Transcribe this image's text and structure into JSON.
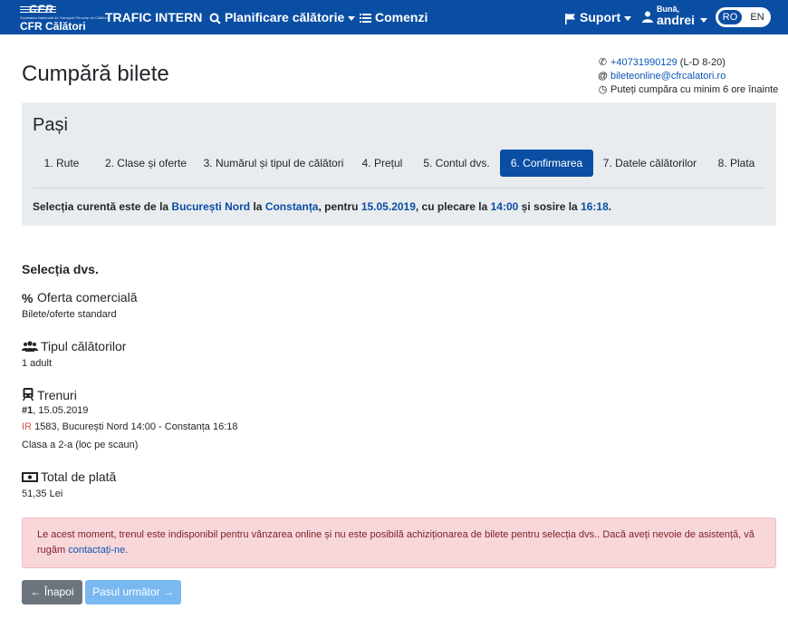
{
  "navbar": {
    "logo_mark": "CFR",
    "logo_tiny": "Societatea Națională de Transport Feroviar de Călători",
    "logo_name": "CFR Călători",
    "trafic": "TRAFIC INTERN",
    "planificare": "Planificare călătorie",
    "comenzi": "Comenzi",
    "suport": "Suport",
    "greeting": "Bună,",
    "username": "andrei",
    "lang_ro": "RO",
    "lang_en": "EN"
  },
  "header": {
    "title": "Cumpără bilete",
    "phone": "+40731990129",
    "phone_hours": "(L-D 8-20)",
    "email": "bileteonline@cfrcalatori.ro",
    "notice": "Puteți cumpăra cu minim 6 ore înainte"
  },
  "steps": {
    "title": "Pași",
    "items": [
      "1. Rute",
      "2. Clase și oferte",
      "3. Numărul și tipul de călători",
      "4. Prețul",
      "5. Contul dvs.",
      "6. Confirmarea",
      "7. Datele călătorilor",
      "8. Plata"
    ],
    "active_index": 5
  },
  "current_selection": {
    "prefix": "Selecția curentă este de la",
    "from": "București Nord",
    "to_word": "la",
    "to": "Constanța",
    "for_word": ", pentru",
    "date": "15.05.2019",
    "depart_word": ", cu plecare la",
    "depart": "14:00",
    "arrive_word": "și sosire la",
    "arrive": "16:18",
    "end": "."
  },
  "selection": {
    "title": "Selecția dvs.",
    "offer_label": "Oferta comercială",
    "offer_value": "Bilete/oferte standard",
    "travelers_label": "Tipul călătorilor",
    "travelers_value": "1 adult",
    "trains_label": "Trenuri",
    "train_num": "#1",
    "train_date": ", 15.05.2019",
    "train_type": "IR",
    "train_route": "1583, București Nord 14:00 - Constanța 16:18",
    "train_class": "Clasa a 2-a (loc pe scaun)",
    "total_label": "Total de plată",
    "total_value": "51,35 Lei"
  },
  "alert": {
    "text": "Le acest moment, trenul este indisponibil pentru vânzarea online și nu este posibilă achiziționarea de bilete pentru selecția dvs.. Dacă aveți nevoie de asistență, vă rugăm",
    "link": "contactați-ne",
    "end": "."
  },
  "buttons": {
    "back": "Înapoi",
    "next": "Pasul următor"
  },
  "colors": {
    "brand": "#0a4ea3",
    "alert_bg": "#f8d7da",
    "back_btn": "#6c757d",
    "next_btn": "#7ab8f2",
    "train_type": "#d9534f"
  }
}
